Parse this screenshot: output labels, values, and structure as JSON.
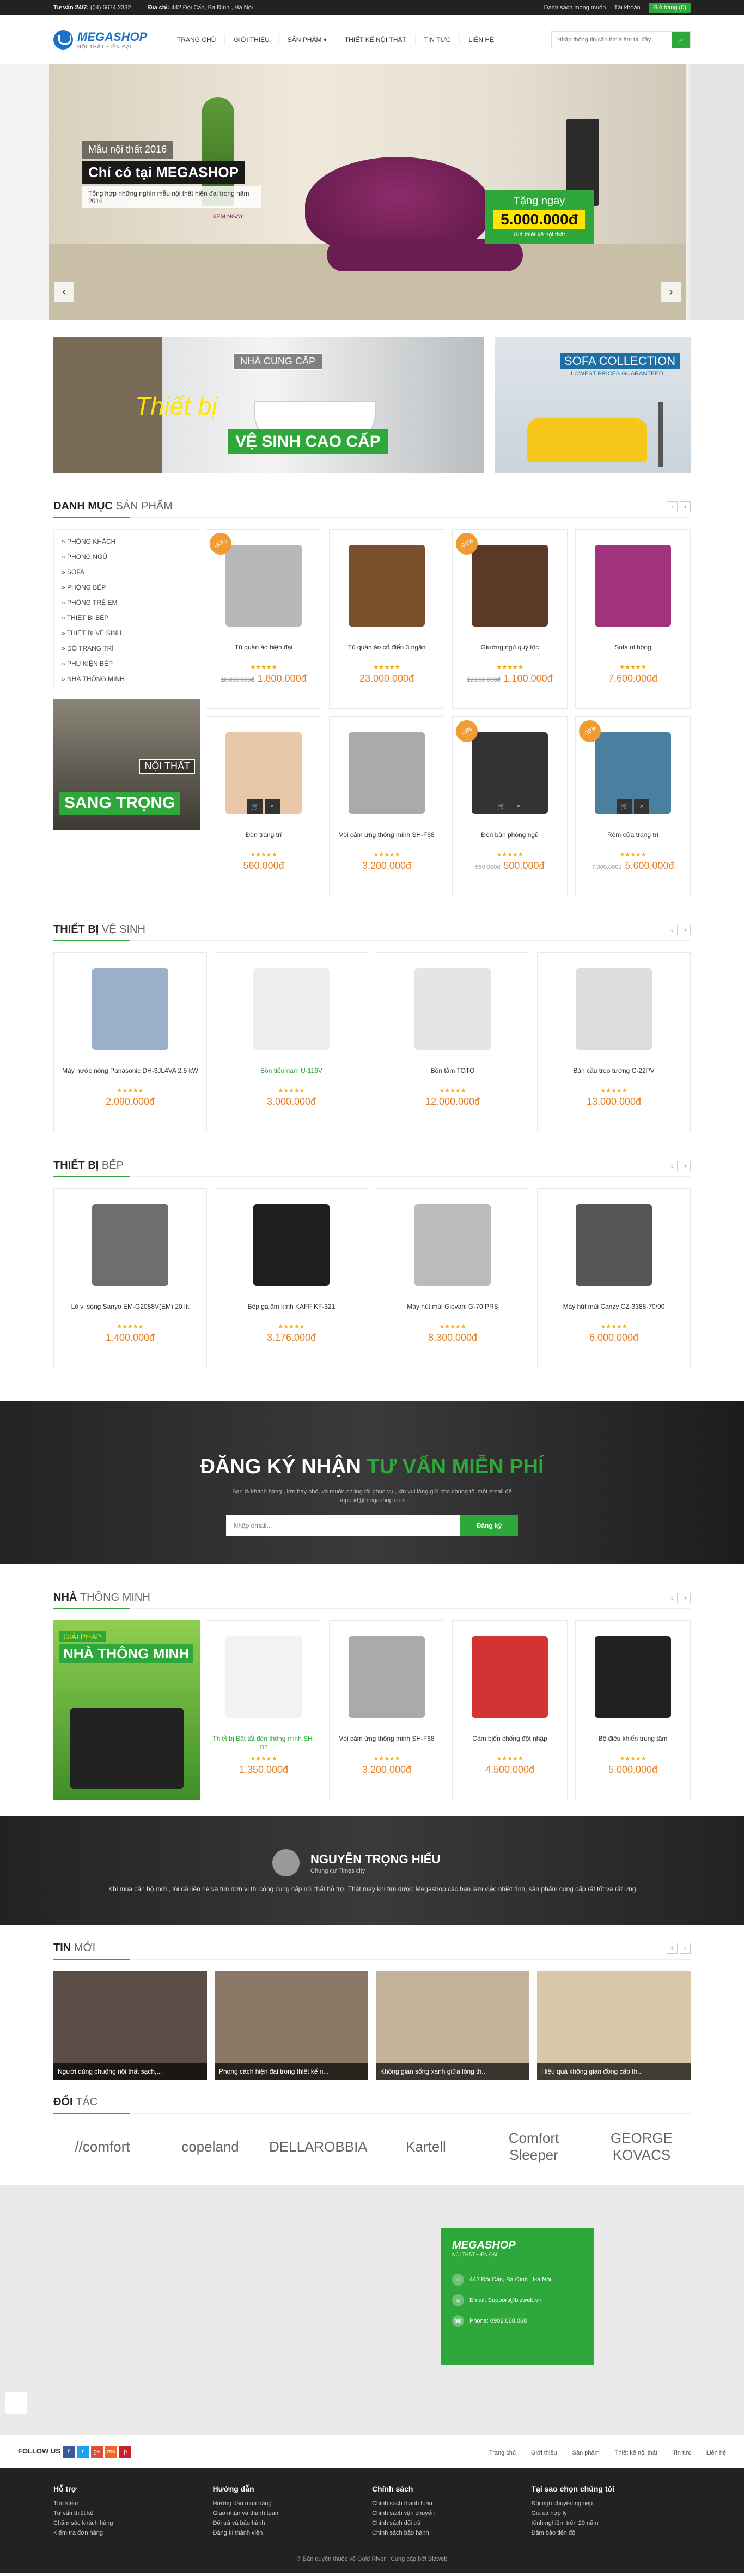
{
  "topbar": {
    "hotline_label": "Tư vấn 24/7:",
    "hotline": "(04) 6674 2332",
    "address_label": "Địa chỉ:",
    "address": "442 Đội Cấn, Ba Đình , Hà Nội",
    "fav": "Danh sách mong muốn",
    "login": "Tài khoản",
    "cart": "Giỏ hàng (0)"
  },
  "header": {
    "brand": "MEGASHOP",
    "tagline": "NỘI THẤT HIỆN ĐẠI",
    "nav": [
      "Trang chủ",
      "Giới thiệu",
      "Sản phẩm ▾",
      "Thiết kế nội thất",
      "Tin tức",
      "Liên hệ"
    ],
    "search_placeholder": "Nhập thông tin cần tìm kiếm tại đây"
  },
  "hero": {
    "c1": "Mẫu nội thất 2016",
    "c2": "Chỉ có tại MEGASHOP",
    "c3": "Tổng hợp những nghìn mẫu nội thất hiện đại trong năm 2016",
    "c4": "XEM NGAY",
    "p1": "Tặng ngay",
    "p2": "5.000.000đ",
    "p3": "Giá thiết kế nội thất",
    "prev": "‹",
    "next": "›"
  },
  "banners": {
    "b1": "NHÀ CUNG CẤP",
    "b2": "Thiết bị",
    "b3": "VỆ SINH CAO CẤP",
    "s1": "SOFA COLLECTION",
    "s2": "LOWEST PRICES GUARANTEED"
  },
  "cat": {
    "title_a": "Danh mục",
    "title_b": "sản phẩm",
    "items": [
      "» Phòng khách",
      "» Phòng ngủ",
      "» Sofa",
      "» Phòng bếp",
      "» Phòng trẻ em",
      "» Thiết bị bếp",
      "» Thiết bị vệ sinh",
      "» Đồ trang trí",
      "» Phụ kiện bếp",
      "» Nhà thông minh"
    ],
    "promo1": "NỘI THẤT",
    "promo2": "SANG TRỌNG",
    "products": [
      {
        "name": "Tủ quần áo hiện đại",
        "old": "18.000.000đ",
        "price": "1.800.000đ",
        "badge": "-50%",
        "color": "#b8b8b8"
      },
      {
        "name": "Tủ quần áo cổ điển 3 ngăn",
        "old": "",
        "price": "23.000.000đ",
        "badge": "",
        "color": "#7a4f2b"
      },
      {
        "name": "Giường ngủ quý tộc",
        "old": "12.000.000đ",
        "price": "1.100.000đ",
        "badge": "-91%",
        "color": "#5a3a26"
      },
      {
        "name": "Sofa nỉ hồng",
        "old": "",
        "price": "7.600.000đ",
        "badge": "",
        "color": "#a0337b"
      },
      {
        "name": "Đèn trang trí",
        "old": "",
        "price": "560.000đ",
        "badge": "",
        "color": "#e8c8a8"
      },
      {
        "name": "Vòi cảm ứng thông minh SH-F68",
        "old": "",
        "price": "3.200.000đ",
        "badge": "",
        "color": "#aaaaaa"
      },
      {
        "name": "Đèn bàn phòng ngủ",
        "old": "550.000đ",
        "price": "500.000đ",
        "badge": "-9%",
        "color": "#333333"
      },
      {
        "name": "Rèm cửa trang trí",
        "old": "7.000.000đ",
        "price": "5.600.000đ",
        "badge": "-20%",
        "color": "#4a7fa0"
      }
    ]
  },
  "wc": {
    "title_a": "Thiết bị",
    "title_b": "vệ sinh",
    "products": [
      {
        "name": "Máy nước nóng Panasonic DH-3JL4VA 2.5 kW",
        "price": "2.090.000đ",
        "color": "#9ab0c8"
      },
      {
        "name": "Bồn tiểu nam U-116V",
        "price": "3.000.000đ",
        "color": "#eeeeee",
        "green": true
      },
      {
        "name": "Bồn tắm TOTO",
        "price": "12.000.000đ",
        "color": "#e5e5e5"
      },
      {
        "name": "Bàn cầu treo tường C-22PV",
        "price": "13.000.000đ",
        "color": "#dddddd"
      }
    ]
  },
  "kitchen": {
    "title_a": "Thiết bị",
    "title_b": "bếp",
    "products": [
      {
        "name": "Lò vi sóng Sanyo EM-G2088V(EM) 20 lít",
        "price": "1.400.000đ",
        "color": "#6e6e6e"
      },
      {
        "name": "Bếp ga âm kính KAFF KF-321",
        "price": "3.176.000đ",
        "color": "#1e1e1e"
      },
      {
        "name": "Máy hút mùi Giovani G-70 PRS",
        "price": "8.300.000đ",
        "color": "#bbbbbb"
      },
      {
        "name": "Máy hút mùi Canzy CZ-3388-70/90",
        "price": "6.000.000đ",
        "color": "#555555"
      }
    ]
  },
  "subscribe": {
    "t1": "ĐĂNG KÝ NHẬN",
    "t2": "TƯ VẤN MIỄN PHÍ",
    "desc": "Bạn là khách hàng , lớn hay nhỏ, và muốn chúng tôi phục vụ , xin vui lòng gửi cho chúng tôi một email để support@megashop.com",
    "placeholder": "Nhập email...",
    "btn": "Đăng ký"
  },
  "smart": {
    "title_a": "Nhà",
    "title_b": "thông minh",
    "s1": "GIẢI PHÁP",
    "s2": "NHÀ THÔNG MINH",
    "products": [
      {
        "name": "Thiết bị Bật tắt đèn thông minh SH-D2",
        "price": "1.350.000đ",
        "color": "#f2f2f2",
        "green": true
      },
      {
        "name": "Vòi cảm ứng thông minh SH-F68",
        "price": "3.200.000đ",
        "color": "#aaaaaa"
      },
      {
        "name": "Cảm biến chống đột nhập",
        "price": "4.500.000đ",
        "color": "#d33333"
      },
      {
        "name": "Bộ điều khiển trung tâm",
        "price": "5.000.000đ",
        "color": "#222222"
      }
    ]
  },
  "testi": {
    "name": "NGUYỄN TRỌNG HIẾU",
    "role": "Chung cư Times city",
    "quote": "Khi mua căn hộ mới , tôi đã liên hệ và tìm đơn vị thi công cung cấp nội thất hỗ trợ. Thật may khi tìm được Megashop,các bạn làm việc nhiệt tình, sản phẩm cung cấp rất tốt và rất ưng."
  },
  "news": {
    "title_a": "Tin",
    "title_b": "mới",
    "items": [
      {
        "t": "Người dùng chuộng nội thất sạch,...",
        "c": "#5a4e46"
      },
      {
        "t": "Phong cách hiện đại trong thiết kế n...",
        "c": "#8a7766"
      },
      {
        "t": "Không gian sống xanh giữa lòng th...",
        "c": "#c2b39a"
      },
      {
        "t": "Hiệu quả không gian đồng cấp th...",
        "c": "#d8c8a8"
      }
    ]
  },
  "partners": {
    "title_a": "Đối",
    "title_b": "tác",
    "items": [
      "//comfort",
      "copeland",
      "DELLAROBBIA",
      "Kartell",
      "Comfort Sleeper",
      "GEORGE KOVACS"
    ]
  },
  "contact": {
    "brand": "MEGASHOP",
    "tag": "NỘI THẤT HIỆN ĐẠI",
    "addr": "442 Đội Cấn, Ba Đình , Hà Nội",
    "email": "Email: Support@bizweb.vn",
    "phone": "Phone: 0902.068.068"
  },
  "follow": {
    "label": "FOLLOW US",
    "links": [
      "Trang chủ",
      "Giới thiệu",
      "Sản phẩm",
      "Thiết kế nội thất",
      "Tin tức",
      "Liên hệ"
    ],
    "social": [
      {
        "n": "f",
        "c": "#3b5998"
      },
      {
        "n": "t",
        "c": "#1da1f2"
      },
      {
        "n": "g+",
        "c": "#dd4b39"
      },
      {
        "n": "rss",
        "c": "#f26522"
      },
      {
        "n": "p",
        "c": "#cb2027"
      }
    ]
  },
  "footer": {
    "cols": [
      {
        "h": "Hỗ trợ",
        "items": [
          "Tìm kiếm",
          "Tư vấn thiết kế",
          "Chăm sóc khách hàng",
          "Kiểm tra đơn hàng"
        ]
      },
      {
        "h": "Hướng dẫn",
        "items": [
          "Hướng dẫn mua hàng",
          "Giao nhận và thanh toán",
          "Đổi trả và bảo hành",
          "Đăng kí thành viên"
        ]
      },
      {
        "h": "Chính sách",
        "items": [
          "Chính sách thanh toán",
          "Chính sách vận chuyển",
          "Chính sách đổi trả",
          "Chính sách bảo hành"
        ]
      },
      {
        "h": "Tại sao chọn chúng tôi",
        "items": [
          "Đội ngũ chuyên nghiệp",
          "Giá cả hợp lý",
          "Kinh nghiệm trên 20 năm",
          "Đảm bảo tiến độ"
        ]
      }
    ],
    "copy": "© Bản quyền thuộc về Gold River | Cung cấp bởi Bizweb"
  }
}
